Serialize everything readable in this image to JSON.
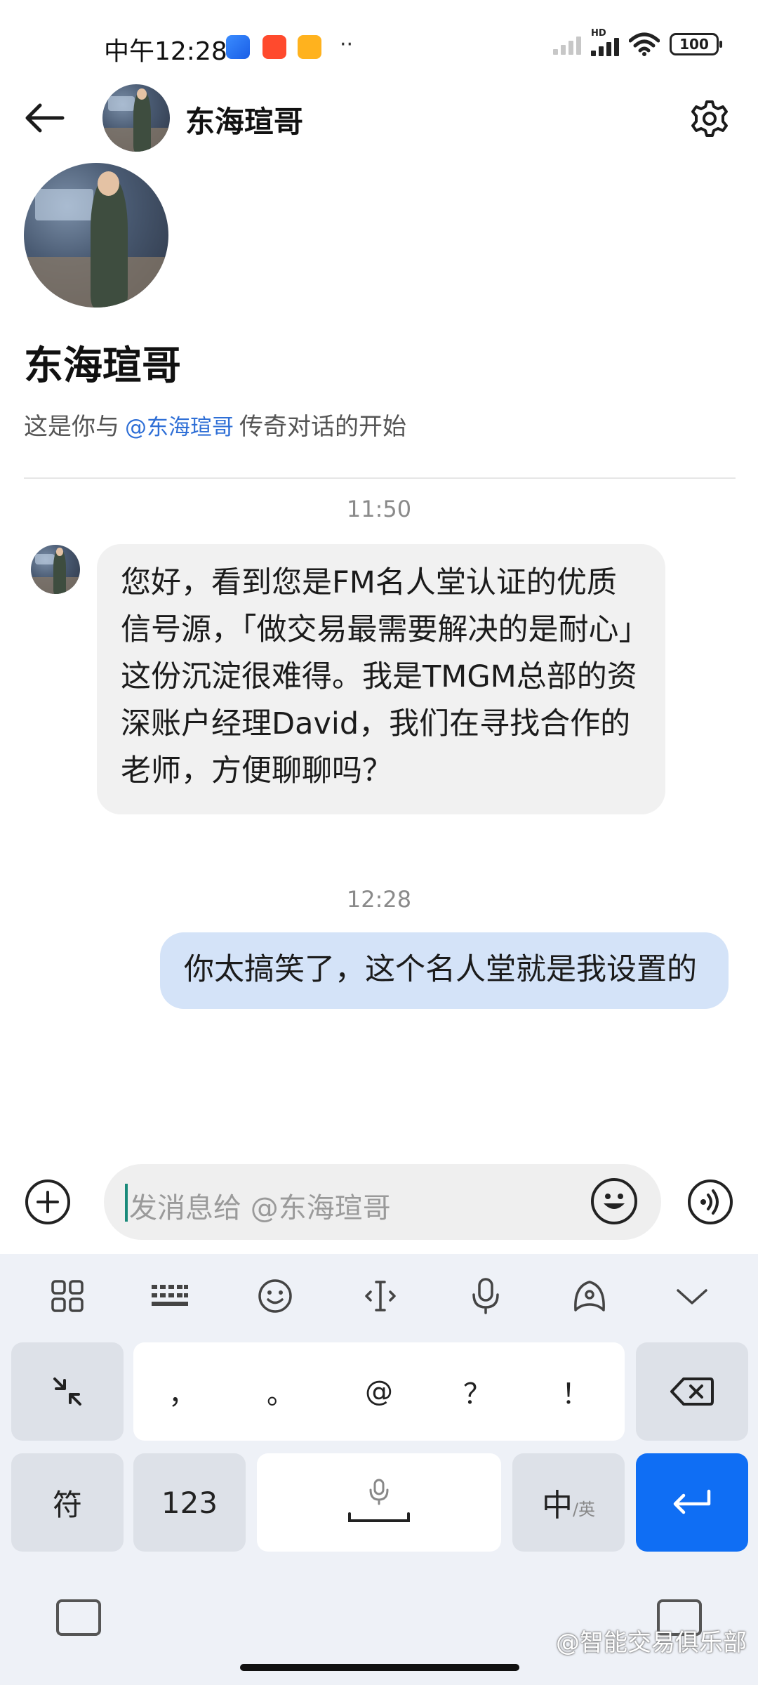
{
  "status_bar": {
    "time": "中午12:28",
    "dots": "··",
    "hd": "HD",
    "battery": "100"
  },
  "header": {
    "contact_name": "东海瑄哥"
  },
  "profile": {
    "name": "东海瑄哥",
    "intro_prefix": "这是你与",
    "intro_mention": "@东海瑄哥",
    "intro_suffix": "传奇对话的开始"
  },
  "messages": [
    {
      "timestamp": "11:50",
      "direction": "incoming",
      "text": "您好，看到您是FM名人堂认证的优质信号源，「做交易最需要解决的是耐心」这份沉淀很难得。我是TMGM总部的资深账户经理David，我们在寻找合作的老师，方便聊聊吗？"
    },
    {
      "timestamp": "12:28",
      "direction": "outgoing",
      "text": "你太搞笑了，这个名人堂就是我设置的"
    }
  ],
  "composer": {
    "placeholder": "发消息给  @东海瑄哥"
  },
  "keyboard": {
    "punctuation": [
      "，",
      "。",
      "@",
      "？",
      "！"
    ],
    "symbols_label": "符",
    "numbers_label": "123",
    "lang_main": "中",
    "lang_alt": "/英"
  },
  "watermark": "@智能交易俱乐部",
  "colors": {
    "accent_blue": "#0f6ef4",
    "mention_blue": "#2f6fd6",
    "outgoing_bubble": "#d4e3f8",
    "incoming_bubble": "#f1f1f1"
  }
}
